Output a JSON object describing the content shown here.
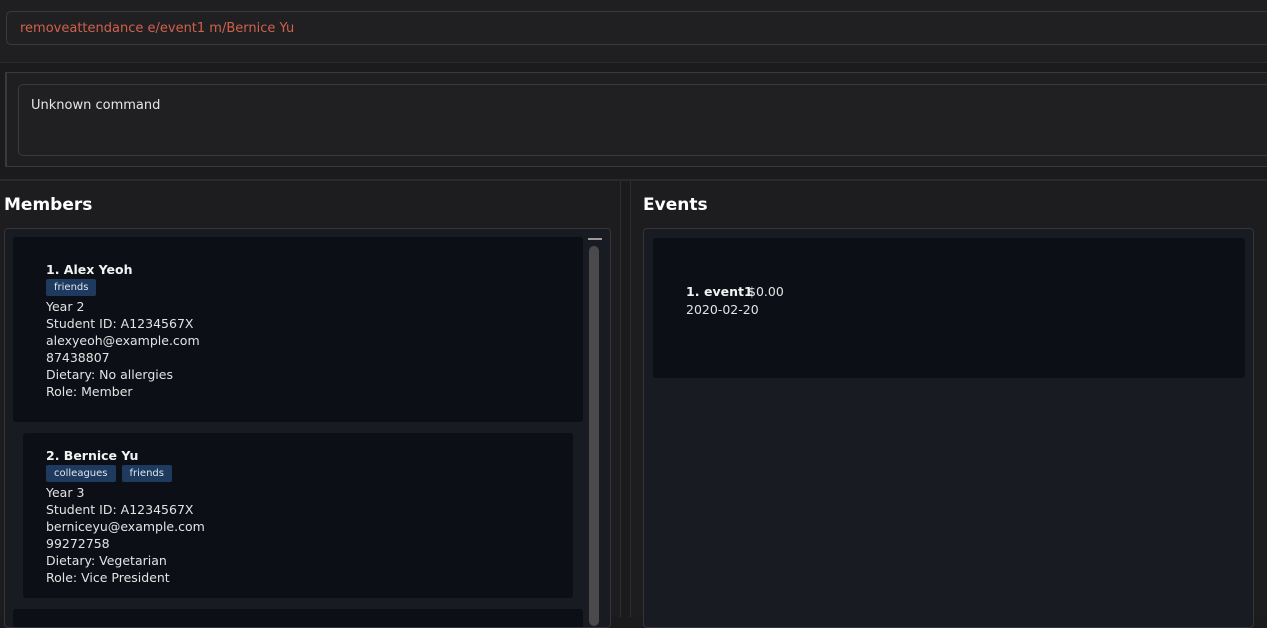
{
  "command": {
    "value": "removeattendance e/event1 m/Bernice Yu"
  },
  "result": {
    "text": "Unknown command"
  },
  "members": {
    "title": "Members",
    "items": [
      {
        "name": "1. Alex Yeoh",
        "tags": [
          "friends"
        ],
        "year": "Year 2",
        "student_id": "Student ID: A1234567X",
        "email": "alexyeoh@example.com",
        "phone": "87438807",
        "dietary": "Dietary: No allergies",
        "role": "Role: Member"
      },
      {
        "name": "2. Bernice Yu",
        "tags": [
          "colleagues",
          "friends"
        ],
        "year": "Year 3",
        "student_id": "Student ID: A1234567X",
        "email": "berniceyu@example.com",
        "phone": "99272758",
        "dietary": "Dietary: Vegetarian",
        "role": "Role: Vice President"
      }
    ]
  },
  "events": {
    "title": "Events",
    "items": [
      {
        "index": "1.",
        "name": "event1",
        "price": "$0.00",
        "date": "2020-02-20"
      }
    ]
  },
  "colors": {
    "command_text": "#d0604c",
    "tag_bg": "#1e3a5f",
    "card_bg": "#0c0f16"
  }
}
